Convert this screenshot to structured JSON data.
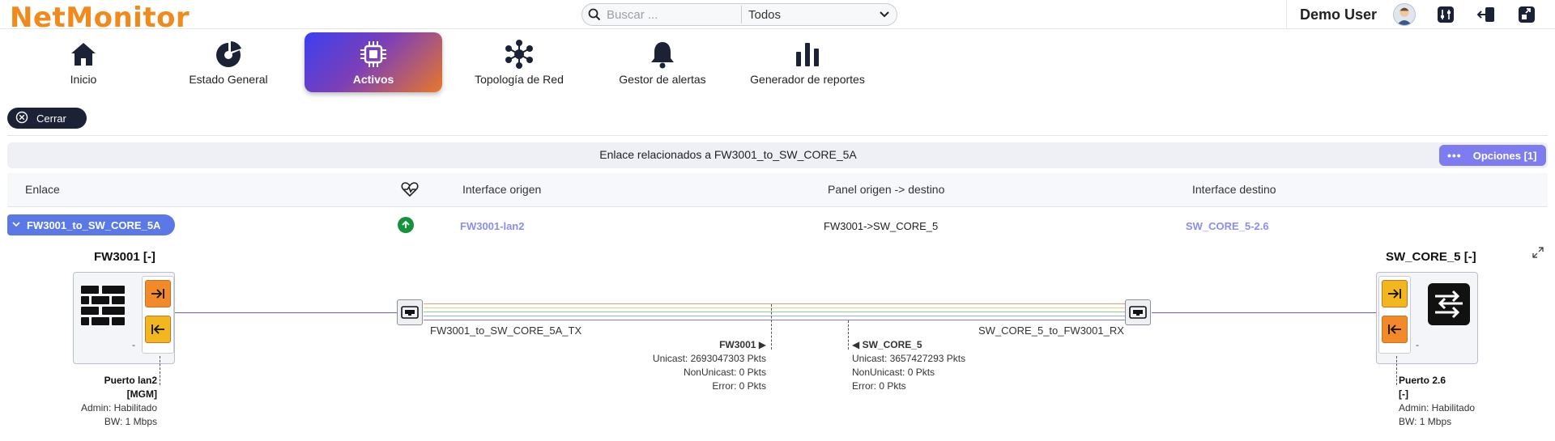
{
  "app": {
    "logo": "NetMonitor"
  },
  "search": {
    "placeholder": "Buscar ...",
    "filter_value": "Todos"
  },
  "user": {
    "name": "Demo User"
  },
  "nav": [
    {
      "label": "Inicio",
      "icon": "home-icon"
    },
    {
      "label": "Estado General",
      "icon": "pie-chart-icon"
    },
    {
      "label": "Activos",
      "icon": "chip-icon",
      "active": true
    },
    {
      "label": "Topología de Red",
      "icon": "network-topology-icon"
    },
    {
      "label": "Gestor de alertas",
      "icon": "bell-icon"
    },
    {
      "label": "Generador de reportes",
      "icon": "bar-chart-icon"
    }
  ],
  "close_label": "Cerrar",
  "panel": {
    "title": "Enlace relacionados a FW3001_to_SW_CORE_5A",
    "options_label": "Opciones [1]"
  },
  "table": {
    "headers": {
      "enlace": "Enlace",
      "interface_origen": "Interface origen",
      "panel": "Panel origen -> destino",
      "interface_destino": "Interface destino"
    },
    "row": {
      "enlace": "FW3001_to_SW_CORE_5A",
      "status": "up",
      "interface_origen": "FW3001-lan2",
      "panel": "FW3001->SW_CORE_5",
      "interface_destino": "SW_CORE_5-2.6"
    }
  },
  "diagram": {
    "left_device": {
      "title": "FW3001 [-]",
      "dash": "-",
      "port_name": "Puerto lan2",
      "port_tag": "[MGM]",
      "admin": "Admin: Habilitado",
      "bw": "BW: 1 Mbps"
    },
    "right_device": {
      "title": "SW_CORE_5 [-]",
      "dash": "-",
      "port_name": "Puerto 2.6",
      "port_tag": "[-]",
      "admin": "Admin: Habilitado",
      "bw": "BW: 1 Mbps"
    },
    "cable_left_label": "FW3001_to_SW_CORE_5A_TX",
    "cable_right_label": "SW_CORE_5_to_FW3001_RX",
    "stats_left": {
      "title": "FW3001 ▶",
      "unicast": "Unicast: 2693047303 Pkts",
      "nonunicast": "NonUnicast: 0 Pkts",
      "error": "Error: 0 Pkts"
    },
    "stats_right": {
      "title": "◀ SW_CORE_5",
      "unicast": "Unicast: 3657427293 Pkts",
      "nonunicast": "NonUnicast: 0 Pkts",
      "error": "Error: 0 Pkts"
    },
    "cable_colors": [
      "#f0a060",
      "#e8d070",
      "#8fd08f",
      "#8ab6e0",
      "#8a7ad8"
    ]
  },
  "colors": {
    "accent_orange": "#f08a1c",
    "status_up": "#17923c",
    "link_purple": "#8a8ef0",
    "pill_blue": "#5b79e6"
  }
}
